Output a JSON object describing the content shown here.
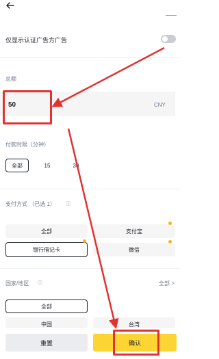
{
  "header": {
    "back_icon": "arrow-left-icon"
  },
  "filter": {
    "verified_only_label": "仅显示认证广告方广告",
    "verified_only_enabled": false
  },
  "amount": {
    "label": "总额",
    "value": "50",
    "currency": "CNY"
  },
  "payment_time": {
    "label": "付款时限（分钟）",
    "options": [
      "全部",
      "15",
      "30"
    ],
    "selected": "全部"
  },
  "payment_method": {
    "label": "支付方式 （已选 1）",
    "options": [
      "全部",
      "支付宝",
      "银行借记卡",
      "微信"
    ],
    "selected": "银行借记卡"
  },
  "region": {
    "label": "国家/地区",
    "all_link": "全部 >",
    "options": [
      "全部",
      "中国",
      "台湾"
    ],
    "selected": "全部"
  },
  "footer": {
    "reset_label": "重置",
    "confirm_label": "确认"
  },
  "colors": {
    "accent": "#fcd535",
    "annotation": "#e23131",
    "badge": "#f0b90b"
  }
}
